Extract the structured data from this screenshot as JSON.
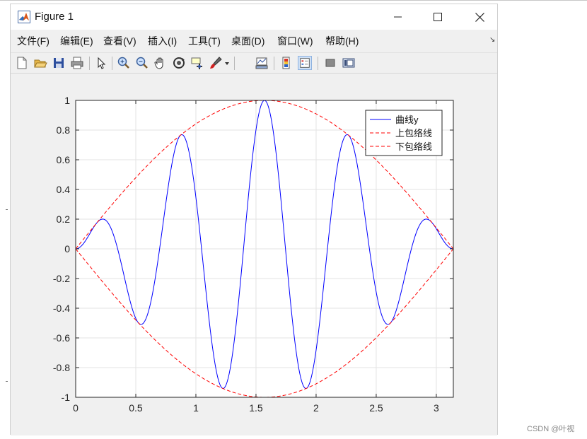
{
  "window": {
    "title": "Figure 1",
    "menu": [
      "文件(F)",
      "编辑(E)",
      "查看(V)",
      "插入(I)",
      "工具(T)",
      "桌面(D)",
      "窗口(W)",
      "帮助(H)"
    ]
  },
  "toolbar": {
    "buttons": [
      "new-figure",
      "open-file",
      "save",
      "print",
      "edit-plot",
      "zoom-in",
      "zoom-out",
      "pan",
      "rotate-3d",
      "data-cursor",
      "brush",
      "link-plot",
      "insert-colorbar",
      "insert-legend",
      "hide-plot-tools",
      "show-plot-tools"
    ]
  },
  "chart_data": {
    "type": "line",
    "xlim": [
      0,
      3.14159
    ],
    "ylim": [
      -1,
      1
    ],
    "xticks": [
      "0",
      "0.5",
      "1",
      "1.5",
      "2",
      "2.5",
      "3"
    ],
    "yticks": [
      "1",
      "0.8",
      "0.6",
      "0.4",
      "0.2",
      "0",
      "-0.2",
      "-0.4",
      "-0.6",
      "-0.8",
      "-1"
    ],
    "grid": true,
    "legend_position": "top-right",
    "series": [
      {
        "name": "曲线y",
        "function": "sin(x)*sin(9x)",
        "color": "#0000ff",
        "style": "solid"
      },
      {
        "name": "上包络线",
        "function": "sin(x)",
        "color": "#ff0000",
        "style": "dashed"
      },
      {
        "name": "下包络线",
        "function": "-sin(x)",
        "color": "#ff0000",
        "style": "dashed"
      }
    ]
  },
  "watermark": "CSDN @叶视"
}
